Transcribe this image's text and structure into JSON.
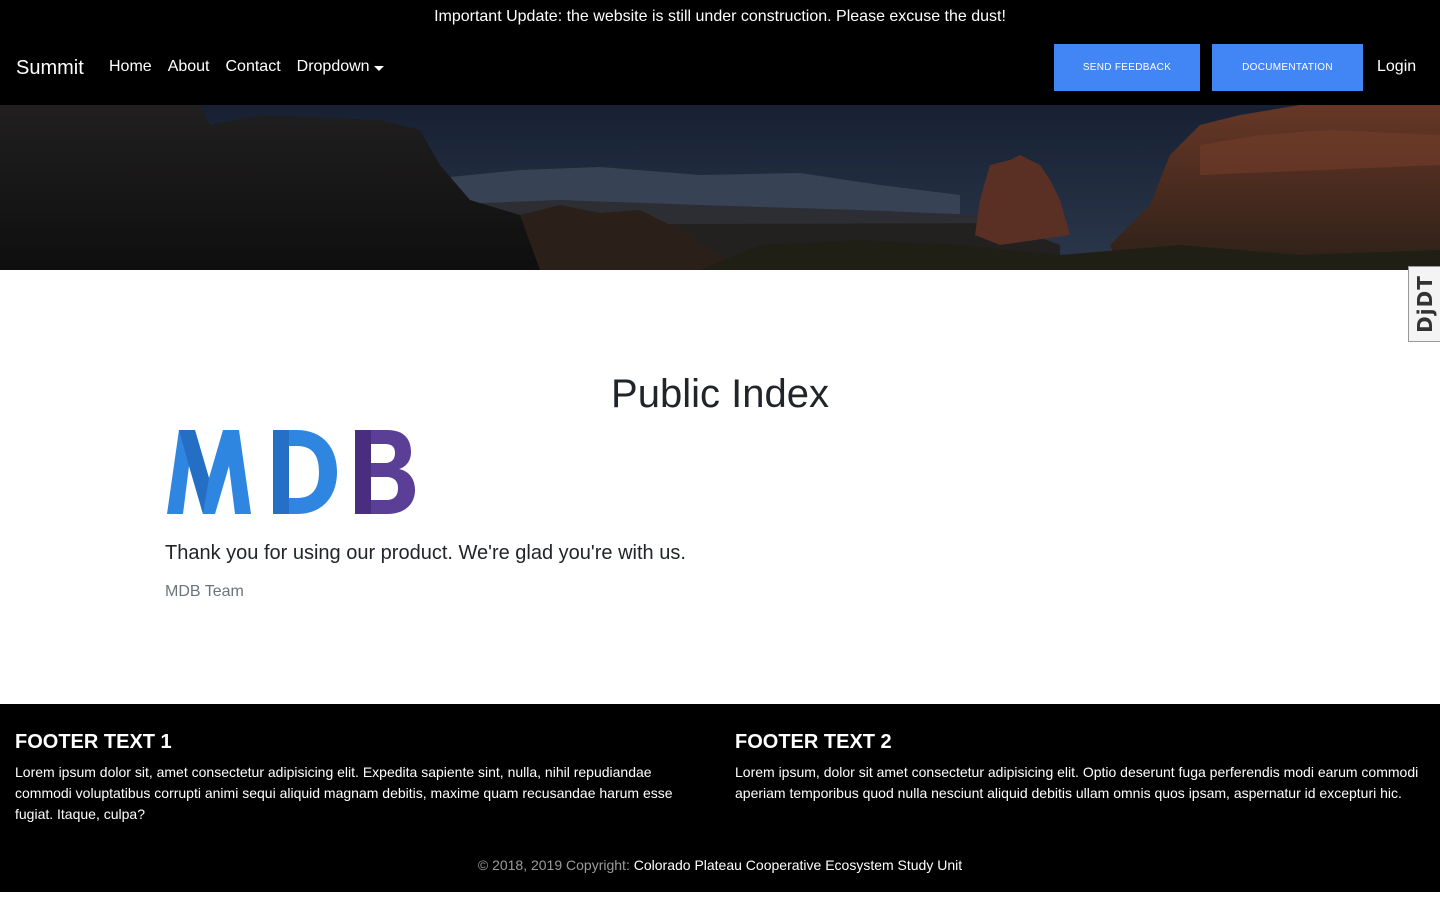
{
  "announcement": "Important Update: the website is still under construction. Please excuse the dust!",
  "navbar": {
    "brand": "Summit",
    "links": [
      "Home",
      "About",
      "Contact",
      "Dropdown"
    ],
    "send_feedback": "SEND FEEDBACK",
    "documentation": "DOCUMENTATION",
    "login": "Login"
  },
  "side_badge": "DjDT",
  "main": {
    "title": "Public Index",
    "logo_text": "MDB",
    "lead": "Thank you for using our product. We're glad you're with us.",
    "signature": "MDB Team"
  },
  "footer": {
    "col1": {
      "heading": "FOOTER TEXT 1",
      "body": "Lorem ipsum dolor sit, amet consectetur adipisicing elit. Expedita sapiente sint, nulla, nihil repudiandae commodi voluptatibus corrupti animi sequi aliquid magnam debitis, maxime quam recusandae harum esse fugiat. Itaque, culpa?"
    },
    "col2": {
      "heading": "FOOTER TEXT 2",
      "body": "Lorem ipsum, dolor sit amet consectetur adipisicing elit. Optio deserunt fuga perferendis modi earum commodi aperiam temporibus quod nulla nesciunt aliquid debitis ullam omnis quos ipsam, aspernatur id excepturi hic."
    },
    "copyright_prefix": "© 2018, 2019 Copyright:",
    "copyright_link": "Colorado Plateau Cooperative Ecosystem Study Unit"
  },
  "colors": {
    "accent": "#4285f4",
    "bar_bg": "#000000",
    "logo_blue": "#2f86e0",
    "logo_purple": "#5b3e96"
  }
}
